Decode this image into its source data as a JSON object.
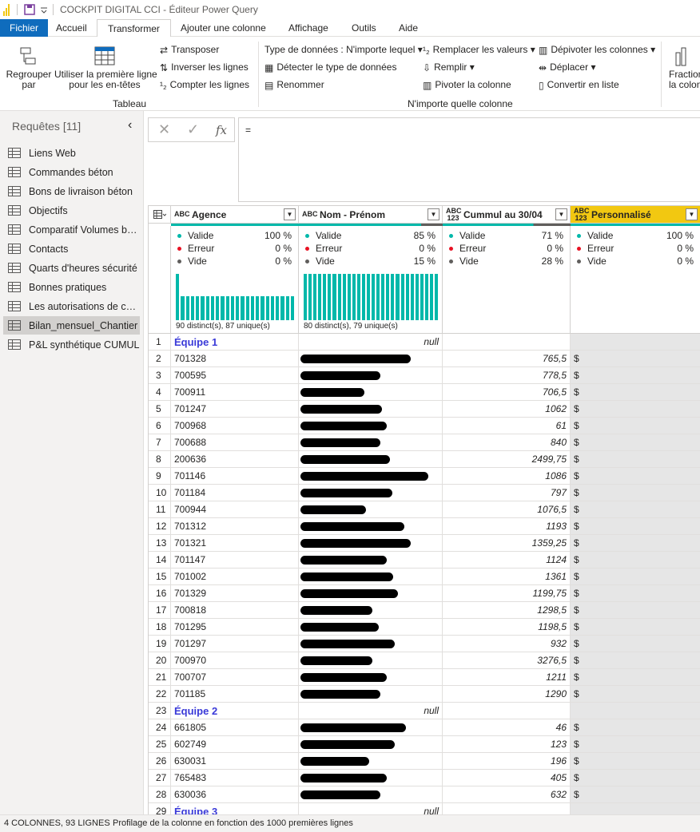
{
  "window": {
    "title": "COCKPIT DIGITAL CCI - Éditeur Power Query"
  },
  "menu": {
    "file": "Fichier",
    "tabs": [
      "Accueil",
      "Transformer",
      "Ajouter une colonne",
      "Affichage",
      "Outils",
      "Aide"
    ],
    "active": "Transformer"
  },
  "ribbon": {
    "group_by": "Regrouper\npar",
    "use_first_row": "Utiliser la première ligne\npour les en-têtes",
    "transpose": "Transposer",
    "reverse_rows": "Inverser les lignes",
    "count_rows": "Compter les lignes",
    "table_group": "Tableau",
    "data_type": "Type de données : N'importe lequel",
    "detect_type": "Détecter le type de données",
    "rename": "Renommer",
    "replace_values": "Remplacer les valeurs",
    "fill": "Remplir",
    "pivot_column": "Pivoter la colonne",
    "unpivot": "Dépivoter les colonnes",
    "move": "Déplacer",
    "convert_list": "Convertir en liste",
    "any_column_group": "N'importe quelle colonne",
    "split_column": "Fraction\nla colon"
  },
  "sidebar": {
    "header": "Requêtes [11]",
    "items": [
      {
        "label": "Liens Web"
      },
      {
        "label": "Commandes béton"
      },
      {
        "label": "Bons de livraison béton"
      },
      {
        "label": "Objectifs"
      },
      {
        "label": "Comparatif Volumes bét..."
      },
      {
        "label": "Contacts"
      },
      {
        "label": "Quarts d'heures sécurité"
      },
      {
        "label": "Bonnes pratiques"
      },
      {
        "label": "Les autorisations de con..."
      },
      {
        "label": "Bilan_mensuel_Chantier"
      },
      {
        "label": "P&L synthétique CUMUL"
      }
    ],
    "selected_index": 9
  },
  "formula": {
    "cancel": "✕",
    "commit": "✓",
    "fx": "fx",
    "text": "="
  },
  "columns": [
    {
      "type": "ABC",
      "name": "Agence",
      "valid": "100 %",
      "error": "0 %",
      "empty": "0 %",
      "distinct": "90 distinct(s), 87 unique(s)",
      "quality": 1.0
    },
    {
      "type": "ABC",
      "name": "Nom - Prénom",
      "valid": "85 %",
      "error": "0 %",
      "empty": "15 %",
      "distinct": "80 distinct(s), 79 unique(s)",
      "quality": 0.85
    },
    {
      "type": "ABC\n123",
      "name": "Cummul au 30/04",
      "valid": "71 %",
      "error": "0 %",
      "empty": "28 %",
      "distinct": "",
      "quality": 0.71
    },
    {
      "type": "ABC\n123",
      "name": "Personnalisé",
      "valid": "100 %",
      "error": "0 %",
      "empty": "0 %",
      "distinct": "",
      "quality": 1.0
    }
  ],
  "profile_labels": {
    "valid": "Valide",
    "error": "Erreur",
    "empty": "Vide"
  },
  "rows": [
    {
      "n": "1",
      "agence": "Équipe 1",
      "group": true,
      "cumul": "null",
      "perso": ""
    },
    {
      "n": "2",
      "agence": "701328",
      "cumul": "765,5",
      "perso": "$"
    },
    {
      "n": "3",
      "agence": "700595",
      "cumul": "778,5",
      "perso": "$"
    },
    {
      "n": "4",
      "agence": "700911",
      "cumul": "706,5",
      "perso": "$"
    },
    {
      "n": "5",
      "agence": "701247",
      "cumul": "1062",
      "perso": "$"
    },
    {
      "n": "6",
      "agence": "700968",
      "cumul": "61",
      "perso": "$"
    },
    {
      "n": "7",
      "agence": "700688",
      "cumul": "840",
      "perso": "$"
    },
    {
      "n": "8",
      "agence": "200636",
      "cumul": "2499,75",
      "perso": "$"
    },
    {
      "n": "9",
      "agence": "701146",
      "cumul": "1086",
      "perso": "$"
    },
    {
      "n": "10",
      "agence": "701184",
      "cumul": "797",
      "perso": "$"
    },
    {
      "n": "11",
      "agence": "700944",
      "cumul": "1076,5",
      "perso": "$"
    },
    {
      "n": "12",
      "agence": "701312",
      "cumul": "1193",
      "perso": "$"
    },
    {
      "n": "13",
      "agence": "701321",
      "cumul": "1359,25",
      "perso": "$"
    },
    {
      "n": "14",
      "agence": "701147",
      "cumul": "1124",
      "perso": "$"
    },
    {
      "n": "15",
      "agence": "701002",
      "cumul": "1361",
      "perso": "$"
    },
    {
      "n": "16",
      "agence": "701329",
      "cumul": "1199,75",
      "perso": "$"
    },
    {
      "n": "17",
      "agence": "700818",
      "cumul": "1298,5",
      "perso": "$"
    },
    {
      "n": "18",
      "agence": "701295",
      "cumul": "1198,5",
      "perso": "$"
    },
    {
      "n": "19",
      "agence": "701297",
      "cumul": "932",
      "perso": "$"
    },
    {
      "n": "20",
      "agence": "700970",
      "cumul": "3276,5",
      "perso": "$"
    },
    {
      "n": "21",
      "agence": "700707",
      "cumul": "1211",
      "perso": "$"
    },
    {
      "n": "22",
      "agence": "701185",
      "cumul": "1290",
      "perso": "$"
    },
    {
      "n": "23",
      "agence": "Équipe 2",
      "group": true,
      "cumul": "null",
      "perso": ""
    },
    {
      "n": "24",
      "agence": "661805",
      "cumul": "46",
      "perso": "$"
    },
    {
      "n": "25",
      "agence": "602749",
      "cumul": "123",
      "perso": "$"
    },
    {
      "n": "26",
      "agence": "630031",
      "cumul": "196",
      "perso": "$"
    },
    {
      "n": "27",
      "agence": "765483",
      "cumul": "405",
      "perso": "$"
    },
    {
      "n": "28",
      "agence": "630036",
      "cumul": "632",
      "perso": "$"
    },
    {
      "n": "29",
      "agence": "Équipe 3",
      "group": true,
      "cumul": "null",
      "perso": ""
    }
  ],
  "status": {
    "cols": "4 COLONNES, 93 LIGNES",
    "profiling": "Profilage de la colonne en fonction des 1000 premières lignes"
  },
  "colors": {
    "accent": "#0f6cbd",
    "quality": "#01b8aa",
    "selected_header": "#f2c811",
    "error": "#e81123",
    "group_text": "#3a3ad8"
  }
}
